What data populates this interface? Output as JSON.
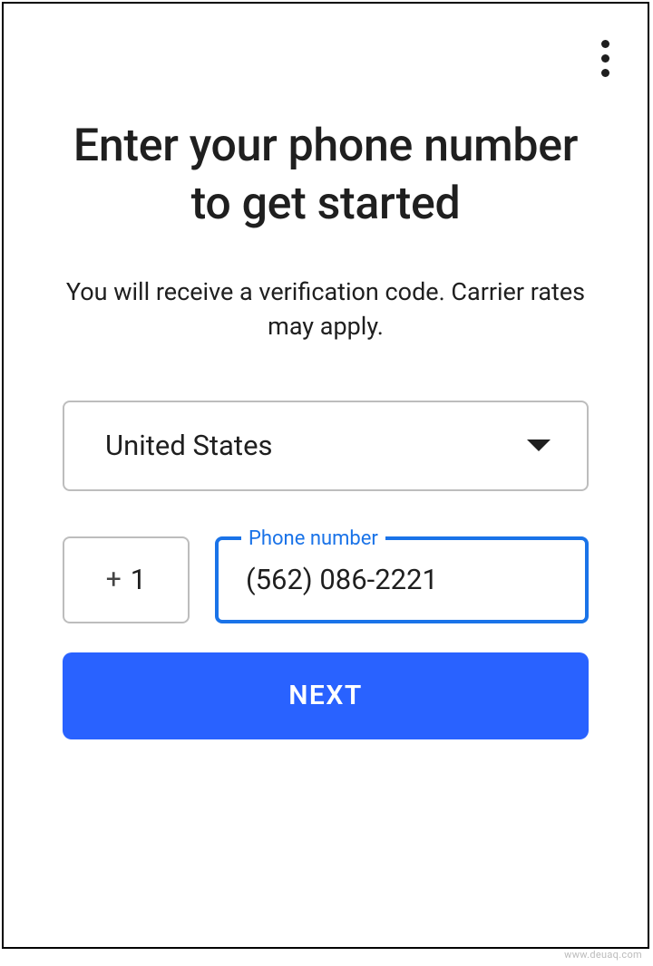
{
  "header": {
    "title": "Enter your phone number to get started",
    "subtitle": "You will receive a verification code. Carrier rates may apply."
  },
  "country_select": {
    "selected": "United States"
  },
  "country_code": {
    "symbol": "+",
    "value": "1"
  },
  "phone_field": {
    "label": "Phone number",
    "value": "(562) 086-2221"
  },
  "buttons": {
    "next": "NEXT"
  },
  "watermark": "www.deuaq.com"
}
